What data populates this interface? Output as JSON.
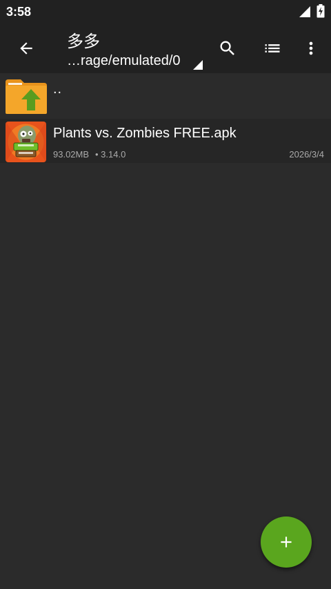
{
  "status_bar": {
    "time": "3:58",
    "icons": [
      "signal-icon",
      "battery-charging-icon"
    ]
  },
  "toolbar": {
    "title": "多多",
    "path": "…rage/emulated/0",
    "icons": [
      "back-arrow-icon",
      "search-icon",
      "list-view-icon",
      "more-vert-icon",
      "dropdown-corner-icon"
    ]
  },
  "files": [
    {
      "name": "..",
      "icon": "folder-up-icon"
    },
    {
      "name": "Plants vs. Zombies FREE.apk",
      "size": "93.02MB",
      "version": "• 3.14.0",
      "date": "2026/3/4",
      "icon": "plants-vs-zombies-app-icon"
    }
  ],
  "fab": {
    "icon": "plus-icon"
  },
  "colors": {
    "background": "#2b2b2b",
    "toolbar": "#212121",
    "accent": "#5aa61e",
    "folder": "#f4a62a",
    "secondary_text": "#aaaaaa"
  }
}
